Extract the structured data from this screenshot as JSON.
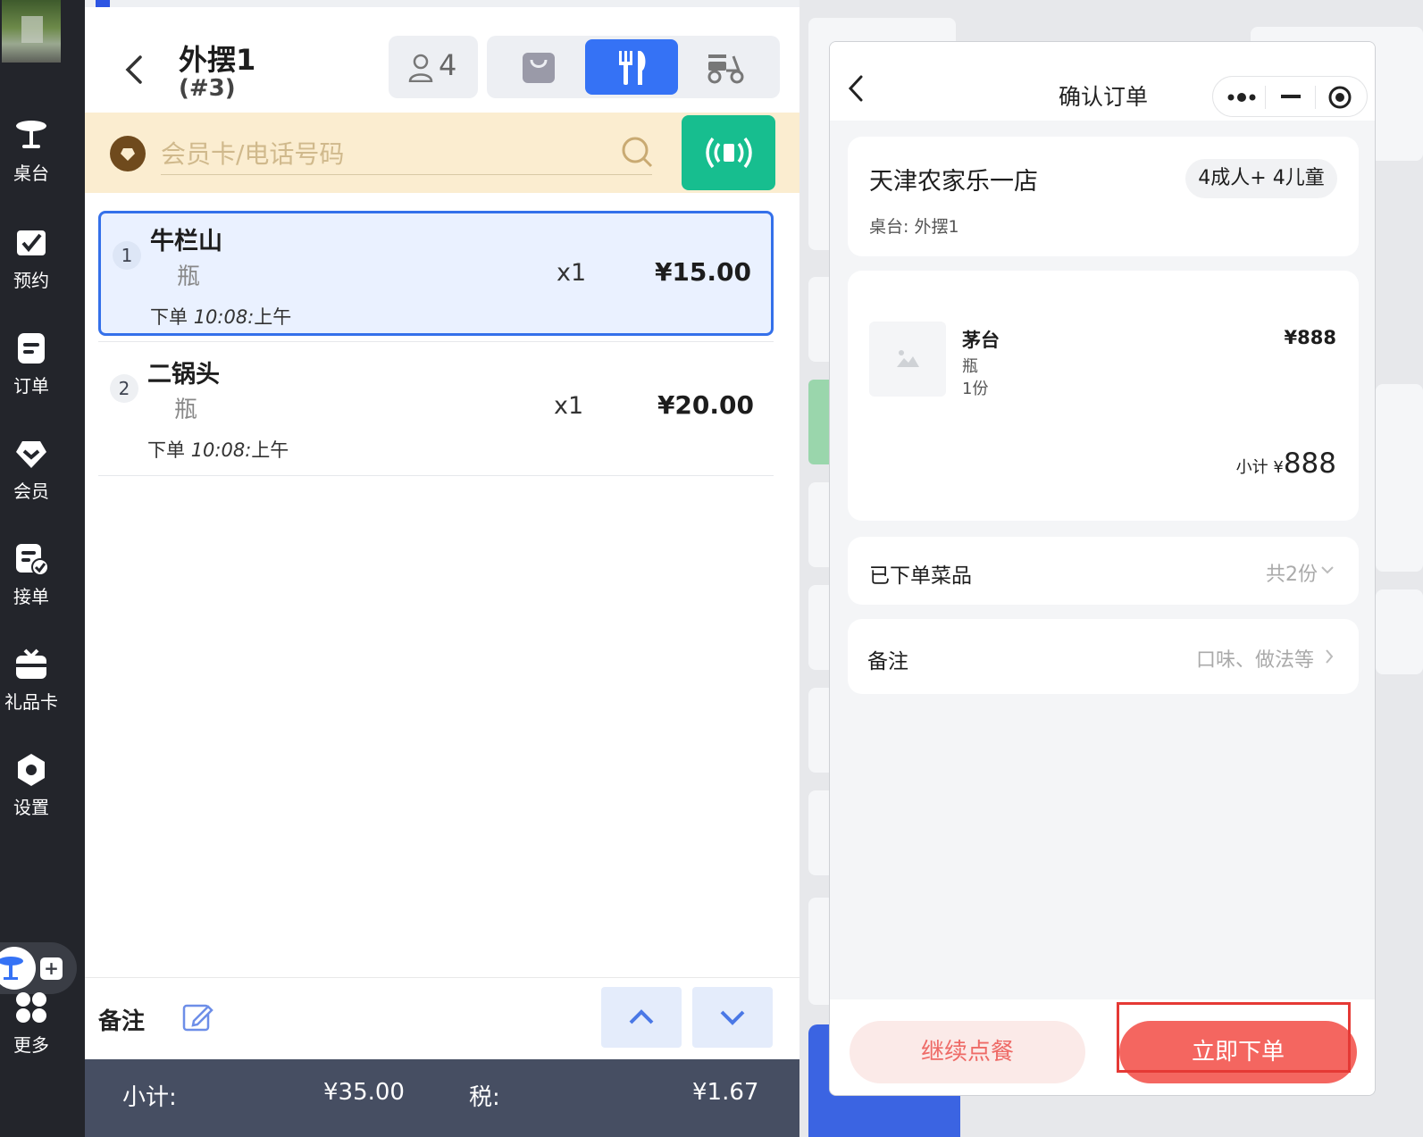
{
  "nav": {
    "items": [
      {
        "label": "桌台",
        "icon": "table-icon"
      },
      {
        "label": "预约",
        "icon": "reservation-icon"
      },
      {
        "label": "订单",
        "icon": "order-icon"
      },
      {
        "label": "会员",
        "icon": "member-icon"
      },
      {
        "label": "接单",
        "icon": "accept-order-icon"
      },
      {
        "label": "礼品卡",
        "icon": "gift-card-icon"
      },
      {
        "label": "设置",
        "icon": "settings-icon"
      }
    ],
    "more_label": "更多"
  },
  "order": {
    "table_name": "外摆1",
    "order_no": "(#3)",
    "guest_count": "4",
    "member_placeholder": "会员卡/电话号码",
    "items": [
      {
        "index": "1",
        "name": "牛栏山",
        "unit": "瓶",
        "qty": "x1",
        "price": "¥15.00",
        "time_prefix": "下单",
        "time": "10:08:",
        "ampm": "上午"
      },
      {
        "index": "2",
        "name": "二锅头",
        "unit": "瓶",
        "qty": "x1",
        "price": "¥20.00",
        "time_prefix": "下单",
        "time": "10:08:",
        "ampm": "上午"
      }
    ],
    "note_label": "备注",
    "subtotal_label": "小计:",
    "subtotal_value": "¥35.00",
    "tax_label": "税:",
    "tax_value": "¥1.67"
  },
  "dialog": {
    "title": "确认订单",
    "store_name": "天津农家乐一店",
    "guests": "4成人+ 4儿童",
    "table_label": "桌台: 外摆1",
    "product": {
      "name": "茅台",
      "unit": "瓶",
      "qty": "1份",
      "price": "¥888"
    },
    "subtotal_prefix": "小计 ¥",
    "subtotal_value": "888",
    "ordered_label": "已下单菜品",
    "ordered_value": "共2份",
    "remark_label": "备注",
    "remark_placeholder": "口味、做法等",
    "continue_label": "继续点餐",
    "submit_label": "立即下单"
  },
  "colors": {
    "accent": "#3572f5",
    "nfc": "#17be8f",
    "submit": "#f46660",
    "highlight": "#e53935"
  }
}
